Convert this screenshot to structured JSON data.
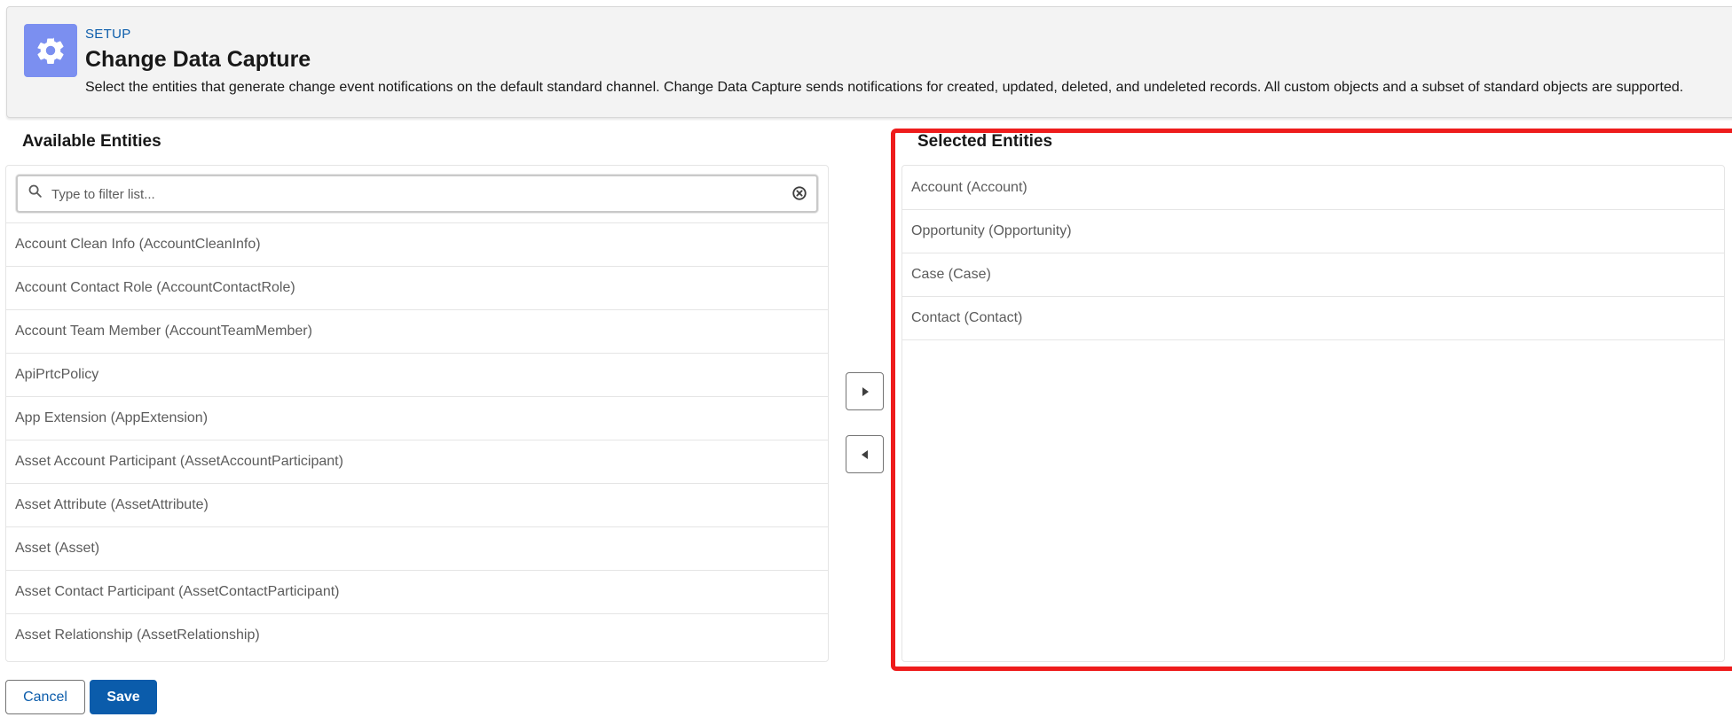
{
  "header": {
    "eyebrow": "SETUP",
    "title": "Change Data Capture",
    "description": "Select the entities that generate change event notifications on the default standard channel. Change Data Capture sends notifications for created, updated, deleted, and undeleted records. All custom objects and a subset of standard objects are supported.",
    "icon": "gear-icon"
  },
  "available": {
    "title": "Available Entities",
    "search_placeholder": "Type to filter list...",
    "items": [
      "Account Clean Info (AccountCleanInfo)",
      "Account Contact Role (AccountContactRole)",
      "Account Team Member (AccountTeamMember)",
      "ApiPrtcPolicy",
      "App Extension (AppExtension)",
      "Asset Account Participant (AssetAccountParticipant)",
      "Asset Attribute (AssetAttribute)",
      "Asset (Asset)",
      "Asset Contact Participant (AssetContactParticipant)",
      "Asset Relationship (AssetRelationship)"
    ]
  },
  "selected": {
    "title": "Selected Entities",
    "items": [
      "Account (Account)",
      "Opportunity (Opportunity)",
      "Case (Case)",
      "Contact (Contact)"
    ]
  },
  "actions": {
    "cancel_label": "Cancel",
    "save_label": "Save"
  },
  "colors": {
    "brand": "#0b5cab",
    "header_icon_bg": "#7b8ff0",
    "highlight": "#ee1c1c"
  }
}
